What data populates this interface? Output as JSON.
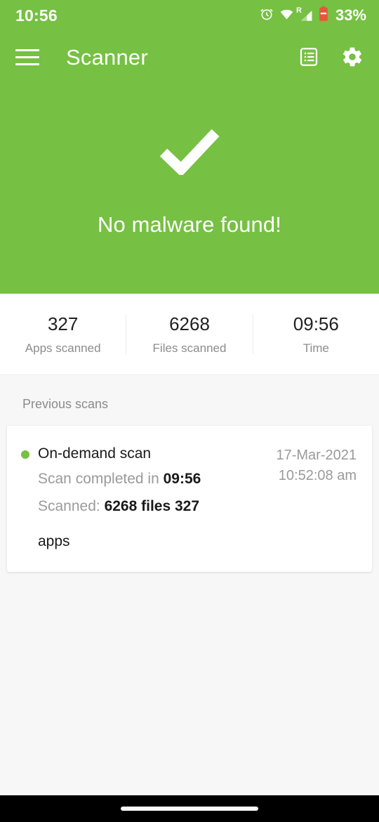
{
  "status_bar": {
    "clock": "10:56",
    "battery_percent": "33%",
    "roaming_label": "R",
    "icons": [
      "alarm-icon",
      "wifi-icon",
      "cellular-signal-icon",
      "battery-icon"
    ]
  },
  "app_bar": {
    "menu_icon": "hamburger-menu-icon",
    "title": "Scanner",
    "log_icon": "scan-log-icon",
    "settings_icon": "gear-icon"
  },
  "hero": {
    "result_icon": "checkmark-icon",
    "message": "No malware found!",
    "background_color": "#76c043"
  },
  "stats": [
    {
      "value": "327",
      "label": "Apps scanned"
    },
    {
      "value": "6268",
      "label": "Files scanned"
    },
    {
      "value": "09:56",
      "label": "Time"
    }
  ],
  "previous_scans": {
    "section_title": "Previous scans",
    "entries": [
      {
        "status_dot_color": "#76c043",
        "title": "On-demand scan",
        "duration_prefix": "Scan completed in ",
        "duration_value": "09:56",
        "scanned_prefix": "Scanned: ",
        "scanned_value": "6268 files 327",
        "scanned_wrap": "apps",
        "date": "17-Mar-2021",
        "time": "10:52:08 am"
      }
    ]
  },
  "nav_bar": {
    "gesture_handle": "home-gesture-pill"
  }
}
